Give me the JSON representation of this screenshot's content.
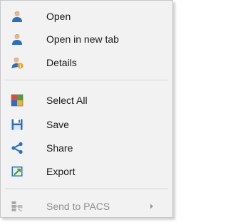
{
  "menu": {
    "items": [
      {
        "label": "Open",
        "icon": "user-icon"
      },
      {
        "label": "Open in new tab",
        "icon": "user-icon"
      },
      {
        "label": "Details",
        "icon": "user-info-icon"
      },
      {
        "label": "Select All",
        "icon": "select-all-icon"
      },
      {
        "label": "Save",
        "icon": "save-icon"
      },
      {
        "label": "Share",
        "icon": "share-icon"
      },
      {
        "label": "Export",
        "icon": "export-icon"
      },
      {
        "label": "Send to PACS",
        "icon": "pacs-icon",
        "disabled": true,
        "has_submenu": true
      }
    ]
  },
  "colors": {
    "menu_bg": "#f2f2f2",
    "border": "#c7c7c7",
    "text": "#1a1a1a",
    "disabled_text": "#8f8f8f",
    "icon_blue": "#2a6fc6"
  }
}
